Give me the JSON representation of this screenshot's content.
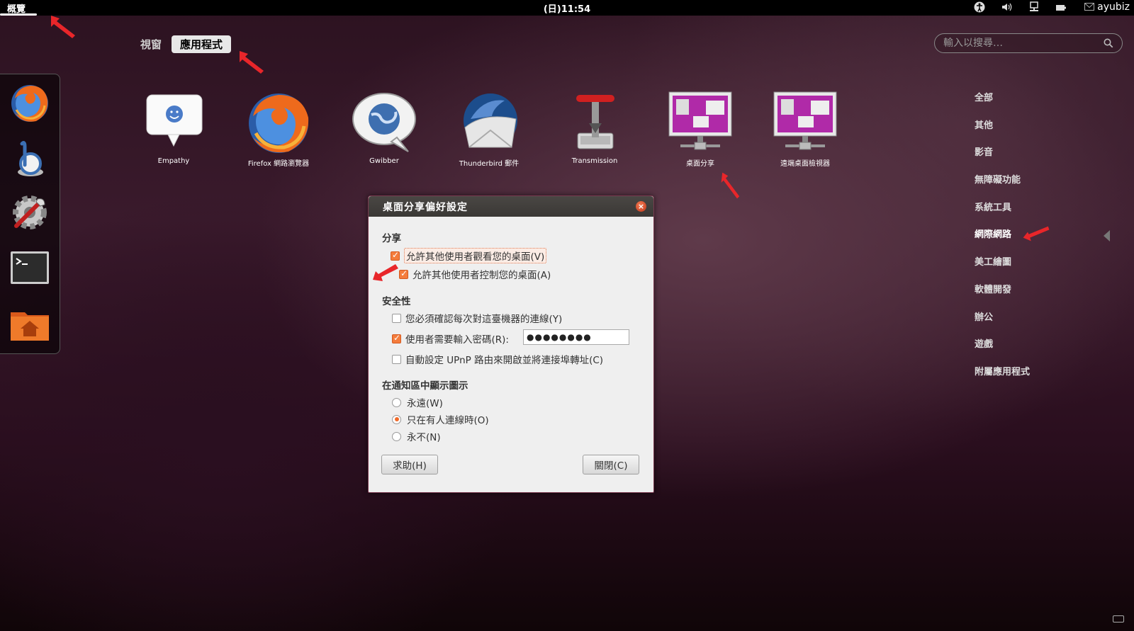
{
  "top_panel": {
    "activities": "概覽",
    "clock": "(日)11:54",
    "username": "ayubiz"
  },
  "view_switch": {
    "windows": "視窗",
    "applications": "應用程式"
  },
  "search": {
    "placeholder": "輸入以搜尋…"
  },
  "apps": [
    {
      "label": "Empathy",
      "icon": "empathy-icon"
    },
    {
      "label": "Firefox 網路瀏覽器",
      "icon": "firefox-icon"
    },
    {
      "label": "Gwibber",
      "icon": "gwibber-icon"
    },
    {
      "label": "Thunderbird 郵件",
      "icon": "thunderbird-icon"
    },
    {
      "label": "Transmission",
      "icon": "transmission-icon"
    },
    {
      "label": "桌面分享",
      "icon": "desktop-sharing-icon"
    },
    {
      "label": "遠端桌面檢視器",
      "icon": "remote-desktop-viewer-icon"
    }
  ],
  "dash": [
    "firefox-icon",
    "banshee-icon",
    "system-settings-icon",
    "terminal-icon",
    "home-folder-icon"
  ],
  "categories": [
    {
      "label": "全部",
      "selected": false
    },
    {
      "label": "其他",
      "selected": false
    },
    {
      "label": "影音",
      "selected": false
    },
    {
      "label": "無障礙功能",
      "selected": false
    },
    {
      "label": "系統工具",
      "selected": false
    },
    {
      "label": "網際網路",
      "selected": true
    },
    {
      "label": "美工繪圖",
      "selected": false
    },
    {
      "label": "軟體開發",
      "selected": false
    },
    {
      "label": "辦公",
      "selected": false
    },
    {
      "label": "遊戲",
      "selected": false
    },
    {
      "label": "附屬應用程式",
      "selected": false
    }
  ],
  "dialog": {
    "title": "桌面分享偏好設定",
    "sharing": {
      "title": "分享",
      "view": {
        "label": "允許其他使用者觀看您的桌面(V)",
        "checked": true
      },
      "control": {
        "label": "允許其他使用者控制您的桌面(A)",
        "checked": true
      }
    },
    "security": {
      "title": "安全性",
      "confirm": {
        "label": "您必須確認每次對這臺機器的連線(Y)",
        "checked": false
      },
      "password": {
        "label": "使用者需要輸入密碼(R):",
        "checked": true,
        "value": "●●●●●●●●"
      },
      "upnp": {
        "label": "自動設定 UPnP 路由來開啟並將連接埠轉址(C)",
        "checked": false
      }
    },
    "notification": {
      "title": "在通知區中顯示圖示",
      "options": [
        {
          "label": "永遠(W)",
          "checked": false
        },
        {
          "label": "只在有人連線時(O)",
          "checked": true
        },
        {
          "label": "永不(N)",
          "checked": false
        }
      ]
    },
    "help_button": "求助(H)",
    "close_button": "關閉(C)"
  },
  "colors": {
    "accent": "#f47c3c",
    "annotation_arrow": "#e8262a"
  }
}
